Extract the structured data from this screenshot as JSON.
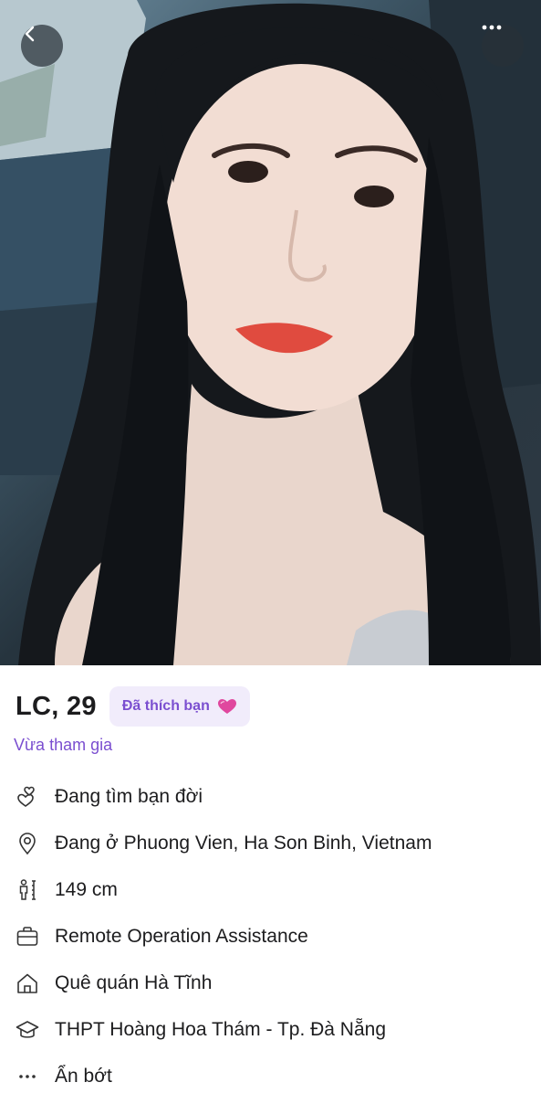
{
  "profile": {
    "name_age": "LC, 29",
    "liked_badge": "Đã thích bạn",
    "joined_status": "Vừa tham gia"
  },
  "attributes": [
    {
      "icon": "relationship-hearts-icon",
      "text": "Đang tìm bạn đời"
    },
    {
      "icon": "location-pin-icon",
      "text": "Đang ở Phuong Vien, Ha Son Binh, Vietnam"
    },
    {
      "icon": "height-icon",
      "text": "149 cm"
    },
    {
      "icon": "briefcase-icon",
      "text": "Remote Operation Assistance"
    },
    {
      "icon": "home-icon",
      "text": "Quê quán Hà Tĩnh"
    },
    {
      "icon": "graduation-cap-icon",
      "text": "THPT Hoàng Hoa Thám - Tp. Đà Nẵng"
    },
    {
      "icon": "more-dots-icon",
      "text": "Ẩn bớt"
    }
  ],
  "colors": {
    "accent": "#7b4fd0",
    "badge_bg": "#f1ecfb",
    "text": "#1c1c1e",
    "heart": "#e0479e"
  }
}
